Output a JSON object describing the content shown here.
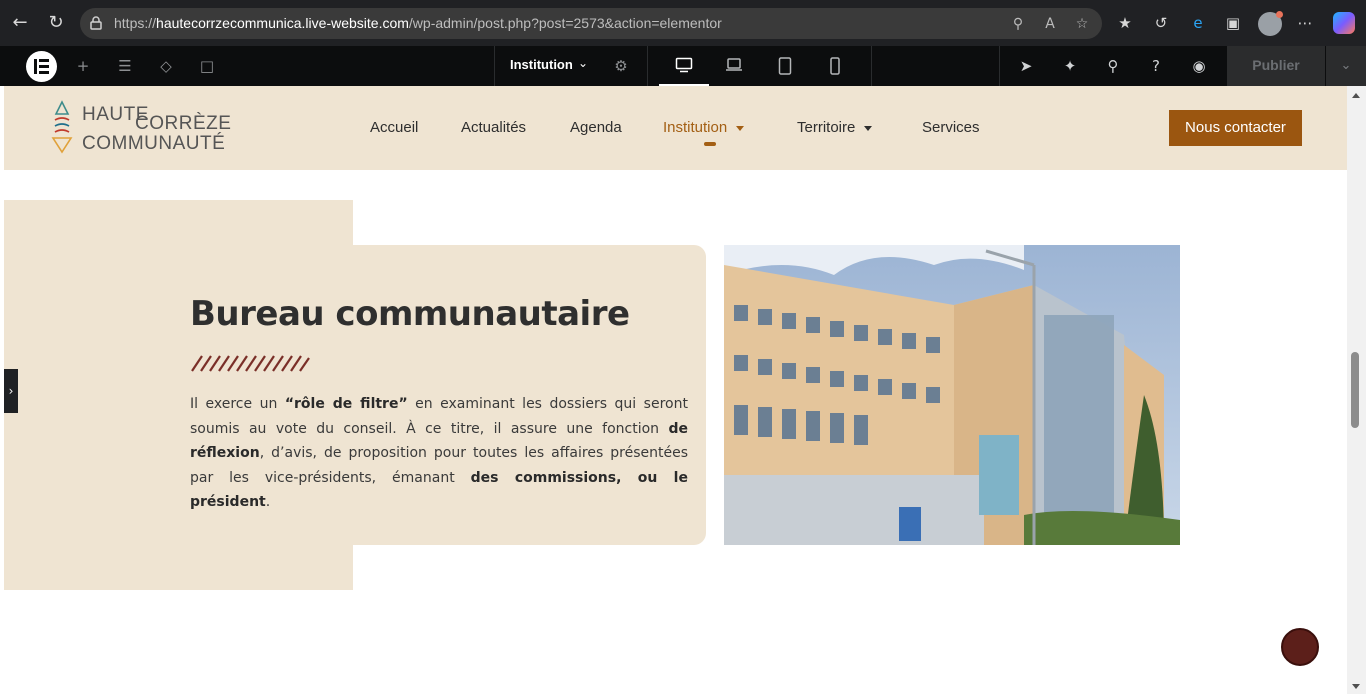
{
  "browser": {
    "url_prefix": "https://",
    "url_domain": "hautecorrzecommunica.live-website.com",
    "url_path": "/wp-admin/post.php?post=2573&action=elementor"
  },
  "elementor": {
    "page_name": "Institution",
    "publish_label": "Publier"
  },
  "site": {
    "logo_line1a": "HAUTE",
    "logo_line1b": "CORRÈZE",
    "logo_line2": "COMMUNAUTÉ",
    "nav": [
      {
        "label": "Accueil"
      },
      {
        "label": "Actualités"
      },
      {
        "label": "Agenda"
      },
      {
        "label": "Institution"
      },
      {
        "label": "Territoire"
      },
      {
        "label": "Services"
      }
    ],
    "cta_label": "Nous contacter",
    "section": {
      "title": "Bureau communautaire",
      "p1": "Il exerce un ",
      "b1": "“rôle de filtre”",
      "p2": " en examinant les dossiers qui seront soumis au vote du conseil. À ce titre, il assure une fonction ",
      "b2": "de réflexion",
      "p3": ", d’avis, de proposition pour toutes les affaires présentées par les vice-présidents, émanant ",
      "b3": "des commissions, ou le président",
      "p4": "."
    }
  },
  "colors": {
    "beige": "#efe4d2",
    "accent": "#9b5610",
    "dark_red": "#5c1f1a"
  }
}
